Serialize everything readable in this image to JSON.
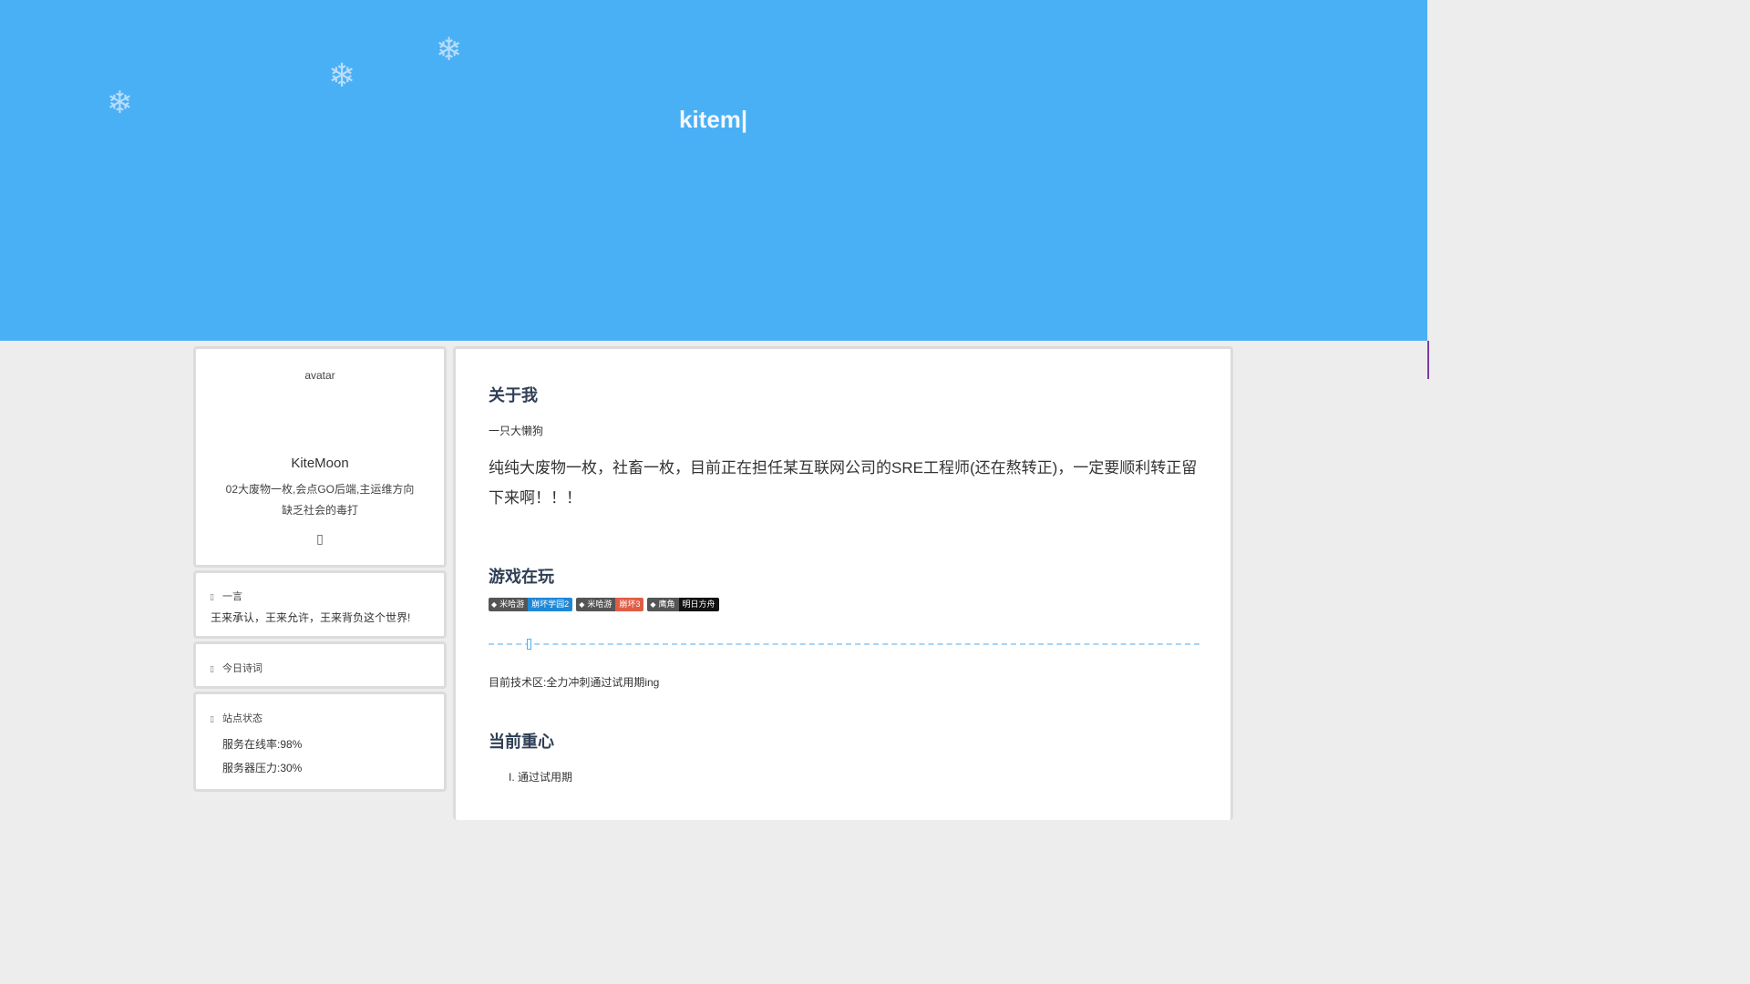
{
  "header": {
    "title": "kitem|",
    "snowflake_glyph": "❄"
  },
  "sidebar": {
    "profile": {
      "avatar_alt": "avatar",
      "name": "KiteMoon",
      "bio_line1": "02大废物一枚,会点GO后端,主运维方向",
      "bio_line2": "缺乏社会的毒打",
      "icon_glyph": "▯",
      "icon_name": "social-icon"
    },
    "hitokoto": {
      "icon_glyph": "▯",
      "title": "一言",
      "text": "王来承认，王来允许，王来背负这个世界!"
    },
    "poem": {
      "icon_glyph": "▯",
      "title": "今日诗词"
    },
    "site_status": {
      "icon_glyph": "▯",
      "title": "站点状态",
      "uptime": "服务在线率:98%",
      "load": "服务器压力:30%"
    }
  },
  "main": {
    "about_heading": "关于我",
    "about_sub": "一只大懒狗",
    "about_para": "纯纯大废物一枚，社畜一枚，目前正在担任某互联网公司的SRE工程师(还在熬转正)，一定要顺利转正留下来啊！！！",
    "games_heading": "游戏在玩",
    "badges": [
      {
        "left": "米哈游",
        "right": "崩坏学园2",
        "color": "#1e88d8"
      },
      {
        "left": "米哈游",
        "right": "崩坏3",
        "color": "#e05d44"
      },
      {
        "left": "鹰角",
        "right": "明日方舟",
        "color": "#111111"
      }
    ],
    "tech_text": "目前技术区:全力冲刺通过试用期ing",
    "focus_heading": "当前重心",
    "focus_items": [
      "I. 通过试用期"
    ]
  }
}
